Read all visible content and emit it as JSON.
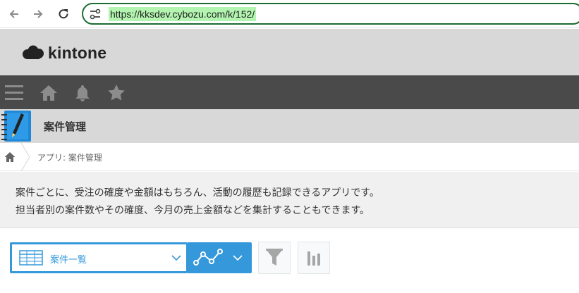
{
  "browser": {
    "url": "https://kksdev.cybozu.com/k/152/",
    "url_highlight_color": "#b3f5b0",
    "url_border_color": "#1d6b34"
  },
  "header": {
    "logo_text": "kintone"
  },
  "global_nav": {
    "icons": [
      "menu-icon",
      "home-icon",
      "bell-icon",
      "star-icon"
    ]
  },
  "app": {
    "title": "案件管理"
  },
  "breadcrumb": {
    "text": "アプリ: 案件管理"
  },
  "description": {
    "line1": "案件ごとに、受注の確度や金額はもちろん、活動の履歴も記録できるアプリです。",
    "line2": "担当者別の案件数やその確度、今月の売上金額などを集計することもできます。"
  },
  "toolbar": {
    "view_label": "案件一覧",
    "accent_color": "#3498db"
  }
}
